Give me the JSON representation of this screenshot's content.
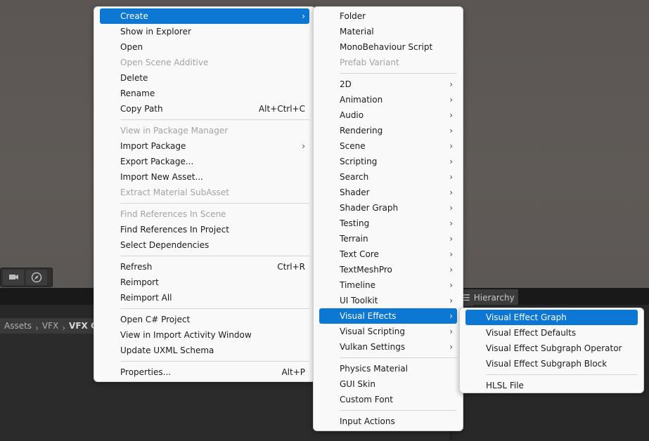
{
  "main_menu": [
    {
      "label": "Create",
      "submenu": true,
      "highlighted": true
    },
    {
      "label": "Show in Explorer"
    },
    {
      "label": "Open"
    },
    {
      "label": "Open Scene Additive",
      "disabled": true
    },
    {
      "label": "Delete"
    },
    {
      "label": "Rename"
    },
    {
      "label": "Copy Path",
      "shortcut": "Alt+Ctrl+C"
    },
    {
      "separator": true
    },
    {
      "label": "View in Package Manager",
      "disabled": true
    },
    {
      "label": "Import Package",
      "submenu": true
    },
    {
      "label": "Export Package..."
    },
    {
      "label": "Import New Asset..."
    },
    {
      "label": "Extract Material SubAsset",
      "disabled": true
    },
    {
      "separator": true
    },
    {
      "label": "Find References In Scene",
      "disabled": true
    },
    {
      "label": "Find References In Project"
    },
    {
      "label": "Select Dependencies"
    },
    {
      "separator": true
    },
    {
      "label": "Refresh",
      "shortcut": "Ctrl+R"
    },
    {
      "label": "Reimport"
    },
    {
      "label": "Reimport All"
    },
    {
      "separator": true
    },
    {
      "label": "Open C# Project"
    },
    {
      "label": "View in Import Activity Window"
    },
    {
      "label": "Update UXML Schema"
    },
    {
      "separator": true
    },
    {
      "label": "Properties...",
      "shortcut": "Alt+P"
    }
  ],
  "create_menu": [
    {
      "label": "Folder"
    },
    {
      "label": "Material"
    },
    {
      "label": "MonoBehaviour Script"
    },
    {
      "label": "Prefab Variant",
      "disabled": true
    },
    {
      "separator": true
    },
    {
      "label": "2D",
      "submenu": true
    },
    {
      "label": "Animation",
      "submenu": true
    },
    {
      "label": "Audio",
      "submenu": true
    },
    {
      "label": "Rendering",
      "submenu": true
    },
    {
      "label": "Scene",
      "submenu": true
    },
    {
      "label": "Scripting",
      "submenu": true
    },
    {
      "label": "Search",
      "submenu": true
    },
    {
      "label": "Shader",
      "submenu": true
    },
    {
      "label": "Shader Graph",
      "submenu": true
    },
    {
      "label": "Testing",
      "submenu": true
    },
    {
      "label": "Terrain",
      "submenu": true
    },
    {
      "label": "Text Core",
      "submenu": true
    },
    {
      "label": "TextMeshPro",
      "submenu": true
    },
    {
      "label": "Timeline",
      "submenu": true
    },
    {
      "label": "UI Toolkit",
      "submenu": true
    },
    {
      "label": "Visual Effects",
      "submenu": true,
      "highlighted": true
    },
    {
      "label": "Visual Scripting",
      "submenu": true
    },
    {
      "label": "Vulkan Settings",
      "submenu": true
    },
    {
      "separator": true
    },
    {
      "label": "Physics Material"
    },
    {
      "label": "GUI Skin"
    },
    {
      "label": "Custom Font"
    },
    {
      "separator": true
    },
    {
      "label": "Input Actions"
    }
  ],
  "vfx_menu": [
    {
      "label": "Visual Effect Graph",
      "highlighted": true
    },
    {
      "label": "Visual Effect Defaults"
    },
    {
      "label": "Visual Effect Subgraph Operator"
    },
    {
      "label": "Visual Effect Subgraph Block"
    },
    {
      "separator": true
    },
    {
      "label": "HLSL File"
    }
  ],
  "hierarchy_tab": {
    "label": "Hierarchy"
  },
  "breadcrumb": {
    "root": "Assets",
    "mid": "VFX",
    "current": "VFX G"
  },
  "colors": {
    "highlight": "#0c78d3",
    "menu_bg": "#f9f9f9",
    "disabled": "#a3a3a3"
  },
  "icons": {
    "submenu": "chevron-right-icon",
    "toolbar": [
      "camera-icon",
      "compass-icon"
    ]
  }
}
